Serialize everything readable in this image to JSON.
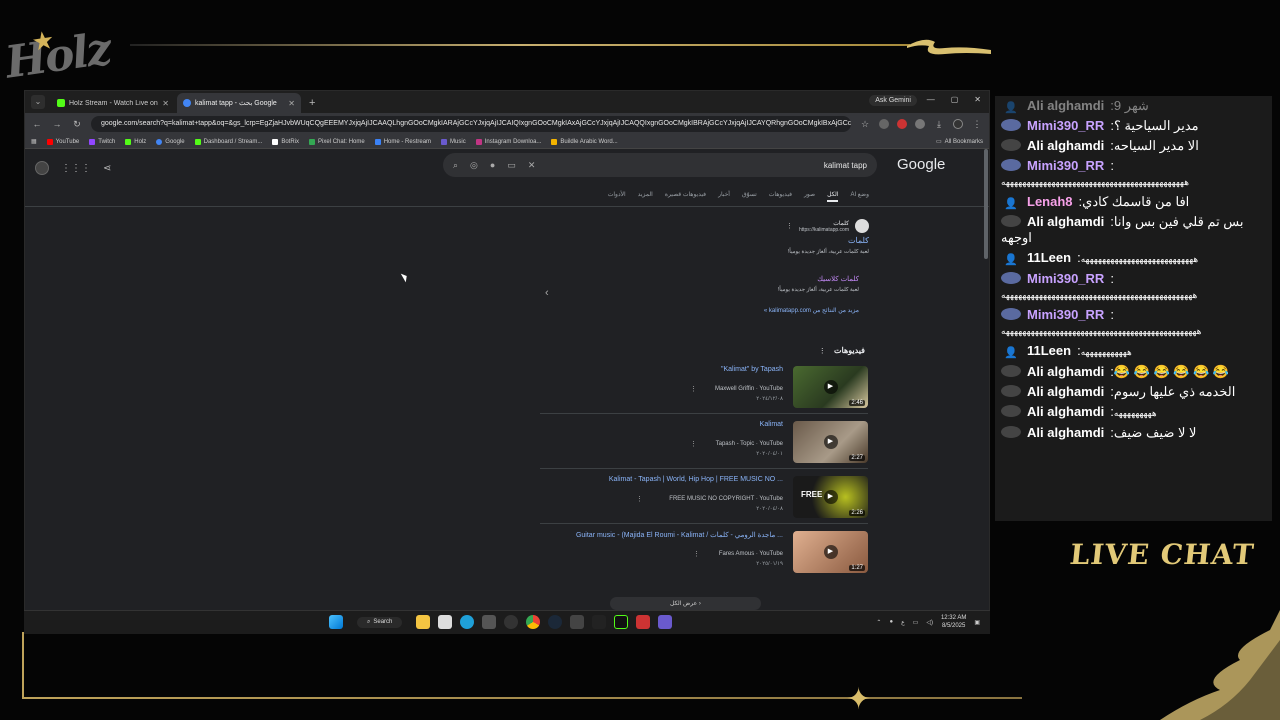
{
  "overlay": {
    "logo_text": "Holz",
    "live_chat_label": "LIVE CHAT"
  },
  "browser": {
    "tabs": [
      {
        "title": "Holz Stream - Watch Live on Ki...",
        "color": "#53fc18"
      },
      {
        "title": "kalimat tapp - بحث Google",
        "color": "#4285f4"
      }
    ],
    "ask_gemini": "Ask Gemini",
    "url": "google.com/search?q=kalimat+tapp&oq=&gs_lcrp=EgZjaHJvbWUqCQgEEEMYJxjqAjIJCAAQLhgnGOoCMgkIARAjGCcYJxjqAjIJCAIQIxgnGOoCMgkIAxAjGCcYJxjqAjIJCAQQIxgnGOoCMgkIBRAjGCcYJxjqAjIJCAYQRhgnGOoCMgkIBxAjGCcYJxjqAjIJCAgQIxgnGOoCMg...",
    "bookmarks": [
      {
        "label": "YouTube",
        "color": "#ff0000"
      },
      {
        "label": "Twitch",
        "color": "#9146ff"
      },
      {
        "label": "Holz",
        "color": "#53fc18"
      },
      {
        "label": "Google",
        "color": "#4285f4"
      },
      {
        "label": "Dashboard / Stream...",
        "color": "#53fc18"
      },
      {
        "label": "BotRix",
        "color": "#ffffff"
      },
      {
        "label": "Pixel Chat: Home",
        "color": "#34a853"
      },
      {
        "label": "Home - Restream",
        "color": "#3b82f6"
      },
      {
        "label": "Music",
        "color": "#6a5acd"
      },
      {
        "label": "Instagram Downloa...",
        "color": "#c13584"
      },
      {
        "label": "Buildle Arabic Word...",
        "color": "#f4b400"
      }
    ],
    "all_bookmarks": "All Bookmarks"
  },
  "google": {
    "query": "kalimat tapp",
    "logo": "Google",
    "filters": [
      "وضع AI",
      "الكل",
      "صور",
      "فيديوهات",
      "تسوّق",
      "أخبار",
      "فيديوهات قصيرة",
      "المزيد",
      "الأدوات"
    ],
    "result": {
      "site_name": "كلمات",
      "site_url": "https://kalimatapp.com",
      "title": "كلمات",
      "desc": "لعبة كلمات عربية، ألغاز جديدة يومياً!",
      "sub_title": "كلمات كلاسيك",
      "sub_desc": "لعبة كلمات عربية، ألغاز جديدة يومياً!",
      "more": "مزيد من النتائج من kalimatapp.com »"
    },
    "videos_header": "فيديوهات",
    "videos": [
      {
        "title": "\"Kalimat\" by Tapash",
        "channel": "Maxwell Griffin · YouTube",
        "date": "٢٠٢٤/١٢/٠٨",
        "duration": "2:46",
        "thumb": "#3a5a2a"
      },
      {
        "title": "Kalimat",
        "channel": "Tapash - Topic · YouTube",
        "date": "٢٠٢٠/٠٤/٠١",
        "duration": "2:27",
        "thumb": "#8a7a6a"
      },
      {
        "title": "Kalimat - Tapash | World, Hip Hop | FREE MUSIC NO ...",
        "channel": "FREE MUSIC NO COPYRIGHT · YouTube",
        "date": "٢٠٢٠/٠٤/٠٨",
        "duration": "2:26",
        "thumb": "#1a1a1a"
      },
      {
        "title": "Guitar music - (Majida El Roumi - Kalimat / ماجدة الرومي - كلمات ...",
        "channel": "Fares Amous · YouTube",
        "date": "٢٠٢٥/٠١/١٩",
        "duration": "1:27",
        "thumb": "#c89070"
      }
    ],
    "show_all": "عرض الكل"
  },
  "taskbar": {
    "search_label": "Search",
    "time": "12:32 AM",
    "date": "8/5/2025"
  },
  "chat": {
    "messages": [
      {
        "user": "Ali alghamdi",
        "text": "شهر 9",
        "color": "#ffffff",
        "icon": "person-icon",
        "faded": true
      },
      {
        "user": "Mimi390_RR",
        "text": "مدير السياحية ؟",
        "color": "#c8a2ff",
        "icon": "avatar-icon"
      },
      {
        "user": "Ali alghamdi",
        "text": "الا مدير السياحه",
        "color": "#ffffff",
        "icon": "avatar-icon"
      },
      {
        "user": "Mimi390_RR",
        "text": "ههههههههههههههههههههههههههههههههههههههههههههه",
        "color": "#c8a2ff",
        "icon": "avatar-icon"
      },
      {
        "user": "Lenah8",
        "text": "افا من قاسمك كادي",
        "color": "#f7a1e9",
        "icon": "person-icon"
      },
      {
        "user": "Ali alghamdi",
        "text": "بس تم قلي فين بس وانا اوجهه",
        "color": "#ffffff",
        "icon": "avatar-icon"
      },
      {
        "user": "11Leen",
        "text": "هههههههههههههههههههههههههههه",
        "color": "#ffffff",
        "icon": "person-icon"
      },
      {
        "user": "Mimi390_RR",
        "text": "ههههههههههههههههههههههههههههههههههههههههههههههه",
        "color": "#c8a2ff",
        "icon": "avatar-icon"
      },
      {
        "user": "Mimi390_RR",
        "text": "هههههههههههههههههههههههههههههههههههههههههههههههه",
        "color": "#c8a2ff",
        "icon": "avatar-icon"
      },
      {
        "user": "11Leen",
        "text": "هههههههههههه",
        "color": "#ffffff",
        "icon": "person-icon"
      },
      {
        "user": "Ali alghamdi",
        "text": "😂 😂 😂 😂 😂 😂",
        "color": "#ffffff",
        "icon": "avatar-icon"
      },
      {
        "user": "Ali alghamdi",
        "text": "الخدمه ذي عليها رسوم",
        "color": "#ffffff",
        "icon": "avatar-icon"
      },
      {
        "user": "Ali alghamdi",
        "text": "هههههههههه",
        "color": "#ffffff",
        "icon": "avatar-icon"
      },
      {
        "user": "Ali alghamdi",
        "text": "لا لا ضيف ضيف",
        "color": "#ffffff",
        "icon": "avatar-icon"
      }
    ]
  }
}
